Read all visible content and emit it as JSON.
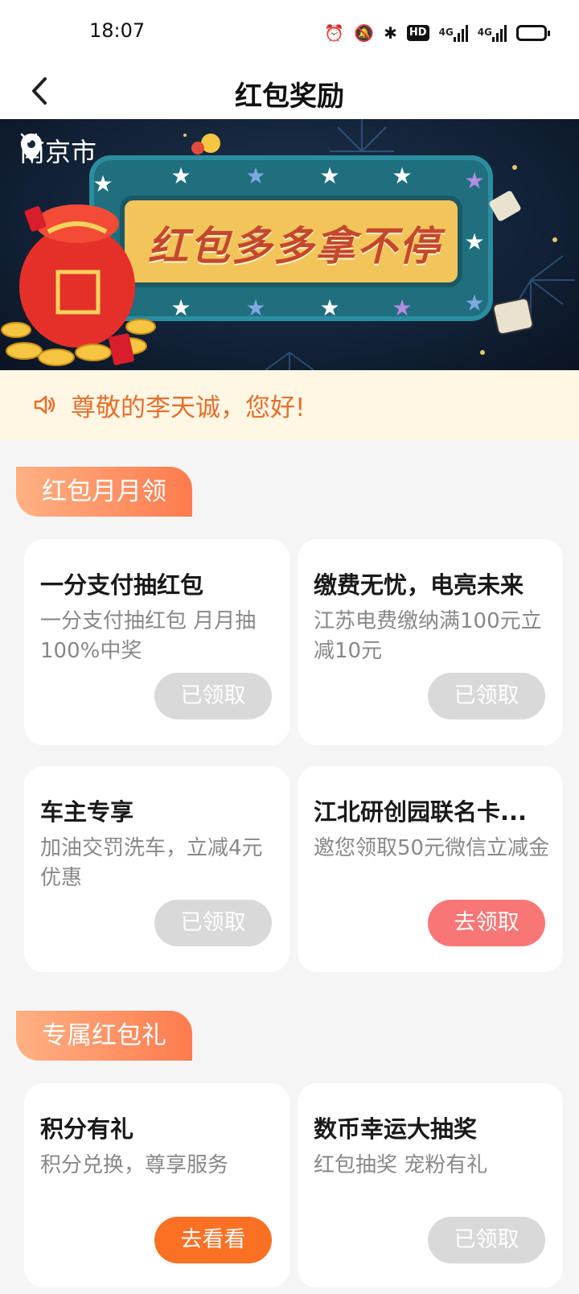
{
  "status_bar": {
    "time": "18:07",
    "network_hd": "HD",
    "signal_label_1": "4G",
    "signal_label_2": "4G"
  },
  "header": {
    "title": "红包奖励"
  },
  "banner": {
    "city": "南京市",
    "slogan": "红包多多拿不停"
  },
  "notice": {
    "greeting": "尊敬的李天诚，您好!"
  },
  "sections": [
    {
      "tag": "红包月月领",
      "cards": [
        {
          "title": "一分支付抽红包",
          "desc": "一分支付抽红包 月月抽100%中奖",
          "button": "已领取",
          "state": "claimed"
        },
        {
          "title": "缴费无忧，电亮未来",
          "desc": "江苏电费缴纳满100元立减10元",
          "button": "已领取",
          "state": "claimed"
        },
        {
          "title": "车主专享",
          "desc": "加油交罚洗车，立减4元优惠",
          "button": "已领取",
          "state": "claimed"
        },
        {
          "title": "江北研创园联名卡...",
          "desc": "邀您领取50元微信立减金",
          "button": "去领取",
          "state": "available"
        }
      ]
    },
    {
      "tag": "专属红包礼",
      "cards": [
        {
          "title": "积分有礼",
          "desc": "积分兑换，尊享服务",
          "button": "去看看",
          "state": "view"
        },
        {
          "title": "数币幸运大抽奖",
          "desc": "红包抽奖 宠粉有礼",
          "button": "已领取",
          "state": "claimed"
        }
      ]
    }
  ],
  "colors": {
    "accent_orange": "#fb7124",
    "accent_pink": "#f87676",
    "claimed_gray": "#d9d9d9",
    "notice_text": "#e66f2b",
    "notice_bg": "#fdf7e4"
  },
  "icons": {
    "back": "chevron-left-icon",
    "location": "location-pin-icon",
    "dropdown": "chevron-down-icon",
    "speaker": "speaker-icon"
  }
}
